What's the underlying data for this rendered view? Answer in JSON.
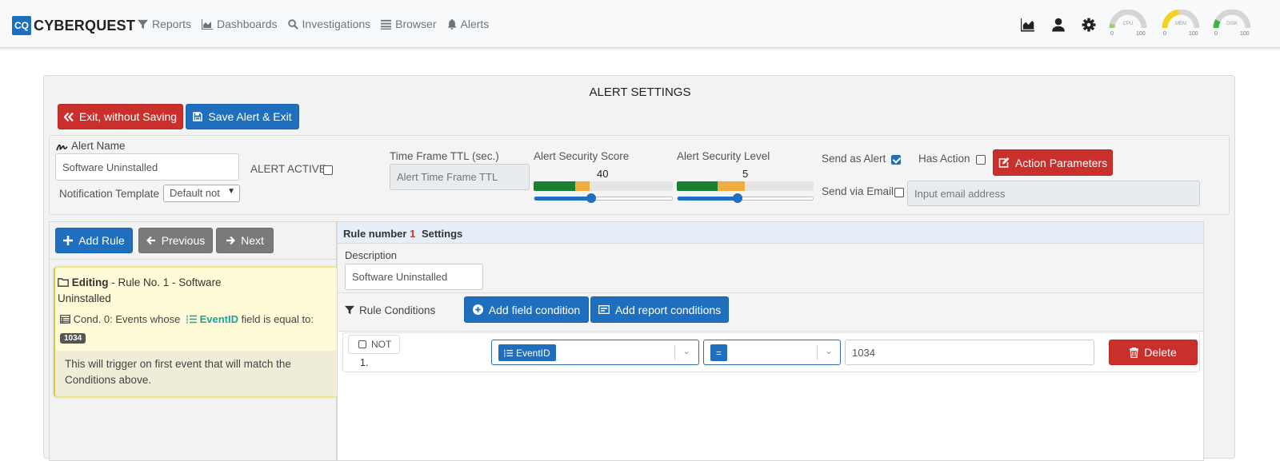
{
  "brand": {
    "logo": "CQ",
    "name": "CYBERQUEST"
  },
  "nav": [
    {
      "label": "Reports",
      "icon": "filter-icon"
    },
    {
      "label": "Dashboards",
      "icon": "area-chart-icon"
    },
    {
      "label": "Investigations",
      "icon": "search-icon"
    },
    {
      "label": "Browser",
      "icon": "list-icon"
    },
    {
      "label": "Alerts",
      "icon": "bell-icon"
    }
  ],
  "gauges": [
    {
      "label": "CPU",
      "min": "0",
      "max": "100",
      "value_fraction": 0.0,
      "color": "#d0d0d0"
    },
    {
      "label": "MEM",
      "min": "0",
      "max": "100",
      "value_fraction": 0.45,
      "color": "#f4d21f"
    },
    {
      "label": "DISK",
      "min": "0",
      "max": "100",
      "value_fraction": 0.12,
      "color": "#39b54a"
    }
  ],
  "page": {
    "title": "ALERT SETTINGS",
    "exit_label": "Exit, without Saving",
    "save_label": "Save Alert & Exit"
  },
  "settings": {
    "alert_name_label": "Alert Name",
    "alert_name_value": "Software Uninstalled",
    "alert_active_label": "ALERT ACTIVE",
    "alert_active_checked": false,
    "notification_template_label": "Notification Template",
    "notification_template_value": "Default not",
    "ttl_label": "Time Frame TTL (sec.)",
    "ttl_placeholder": "Alert Time Frame TTL",
    "score_label": "Alert Security Score",
    "score_value": "40",
    "score_fraction": 0.4,
    "level_label": "Alert Security Level",
    "level_value": "5",
    "level_fraction": 0.5,
    "send_alert_label": "Send as Alert",
    "send_alert_checked": true,
    "has_action_label": "Has Action",
    "has_action_checked": false,
    "action_params_label": "Action Parameters",
    "send_email_label": "Send via Email",
    "send_email_checked": false,
    "email_placeholder": "Input email address"
  },
  "rules_nav": {
    "add_rule_label": "Add Rule",
    "previous_label": "Previous",
    "next_label": "Next"
  },
  "rule_card": {
    "editing_label": "Editing",
    "editing_rest": " - Rule No. 1 - Software",
    "editing_line2": "Uninstalled",
    "cond_prefix": "Cond. 0: Events whose",
    "cond_field": "EventID",
    "cond_suffix": "field is equal to:",
    "cond_value": "1034",
    "trigger_note": "This will trigger on first event that will match the Conditions above."
  },
  "rule_settings": {
    "header_prefix": "Rule number",
    "rule_number": "1",
    "header_suffix": "Settings",
    "description_label": "Description",
    "description_value": "Software Uninstalled",
    "conditions_label": "Rule Conditions",
    "add_field_condition_label": "Add field condition",
    "add_report_conditions_label": "Add report conditions",
    "condition": {
      "not_label": "NOT",
      "index": "1.",
      "field": "EventID",
      "operator": "=",
      "value": "1034",
      "delete_label": "Delete"
    }
  },
  "colors": {
    "primary": "#1e70bf",
    "danger": "#c9302c",
    "secondary": "#7a7a7a",
    "score_green": "#1a7f31",
    "score_orange": "#f0ac3e"
  }
}
